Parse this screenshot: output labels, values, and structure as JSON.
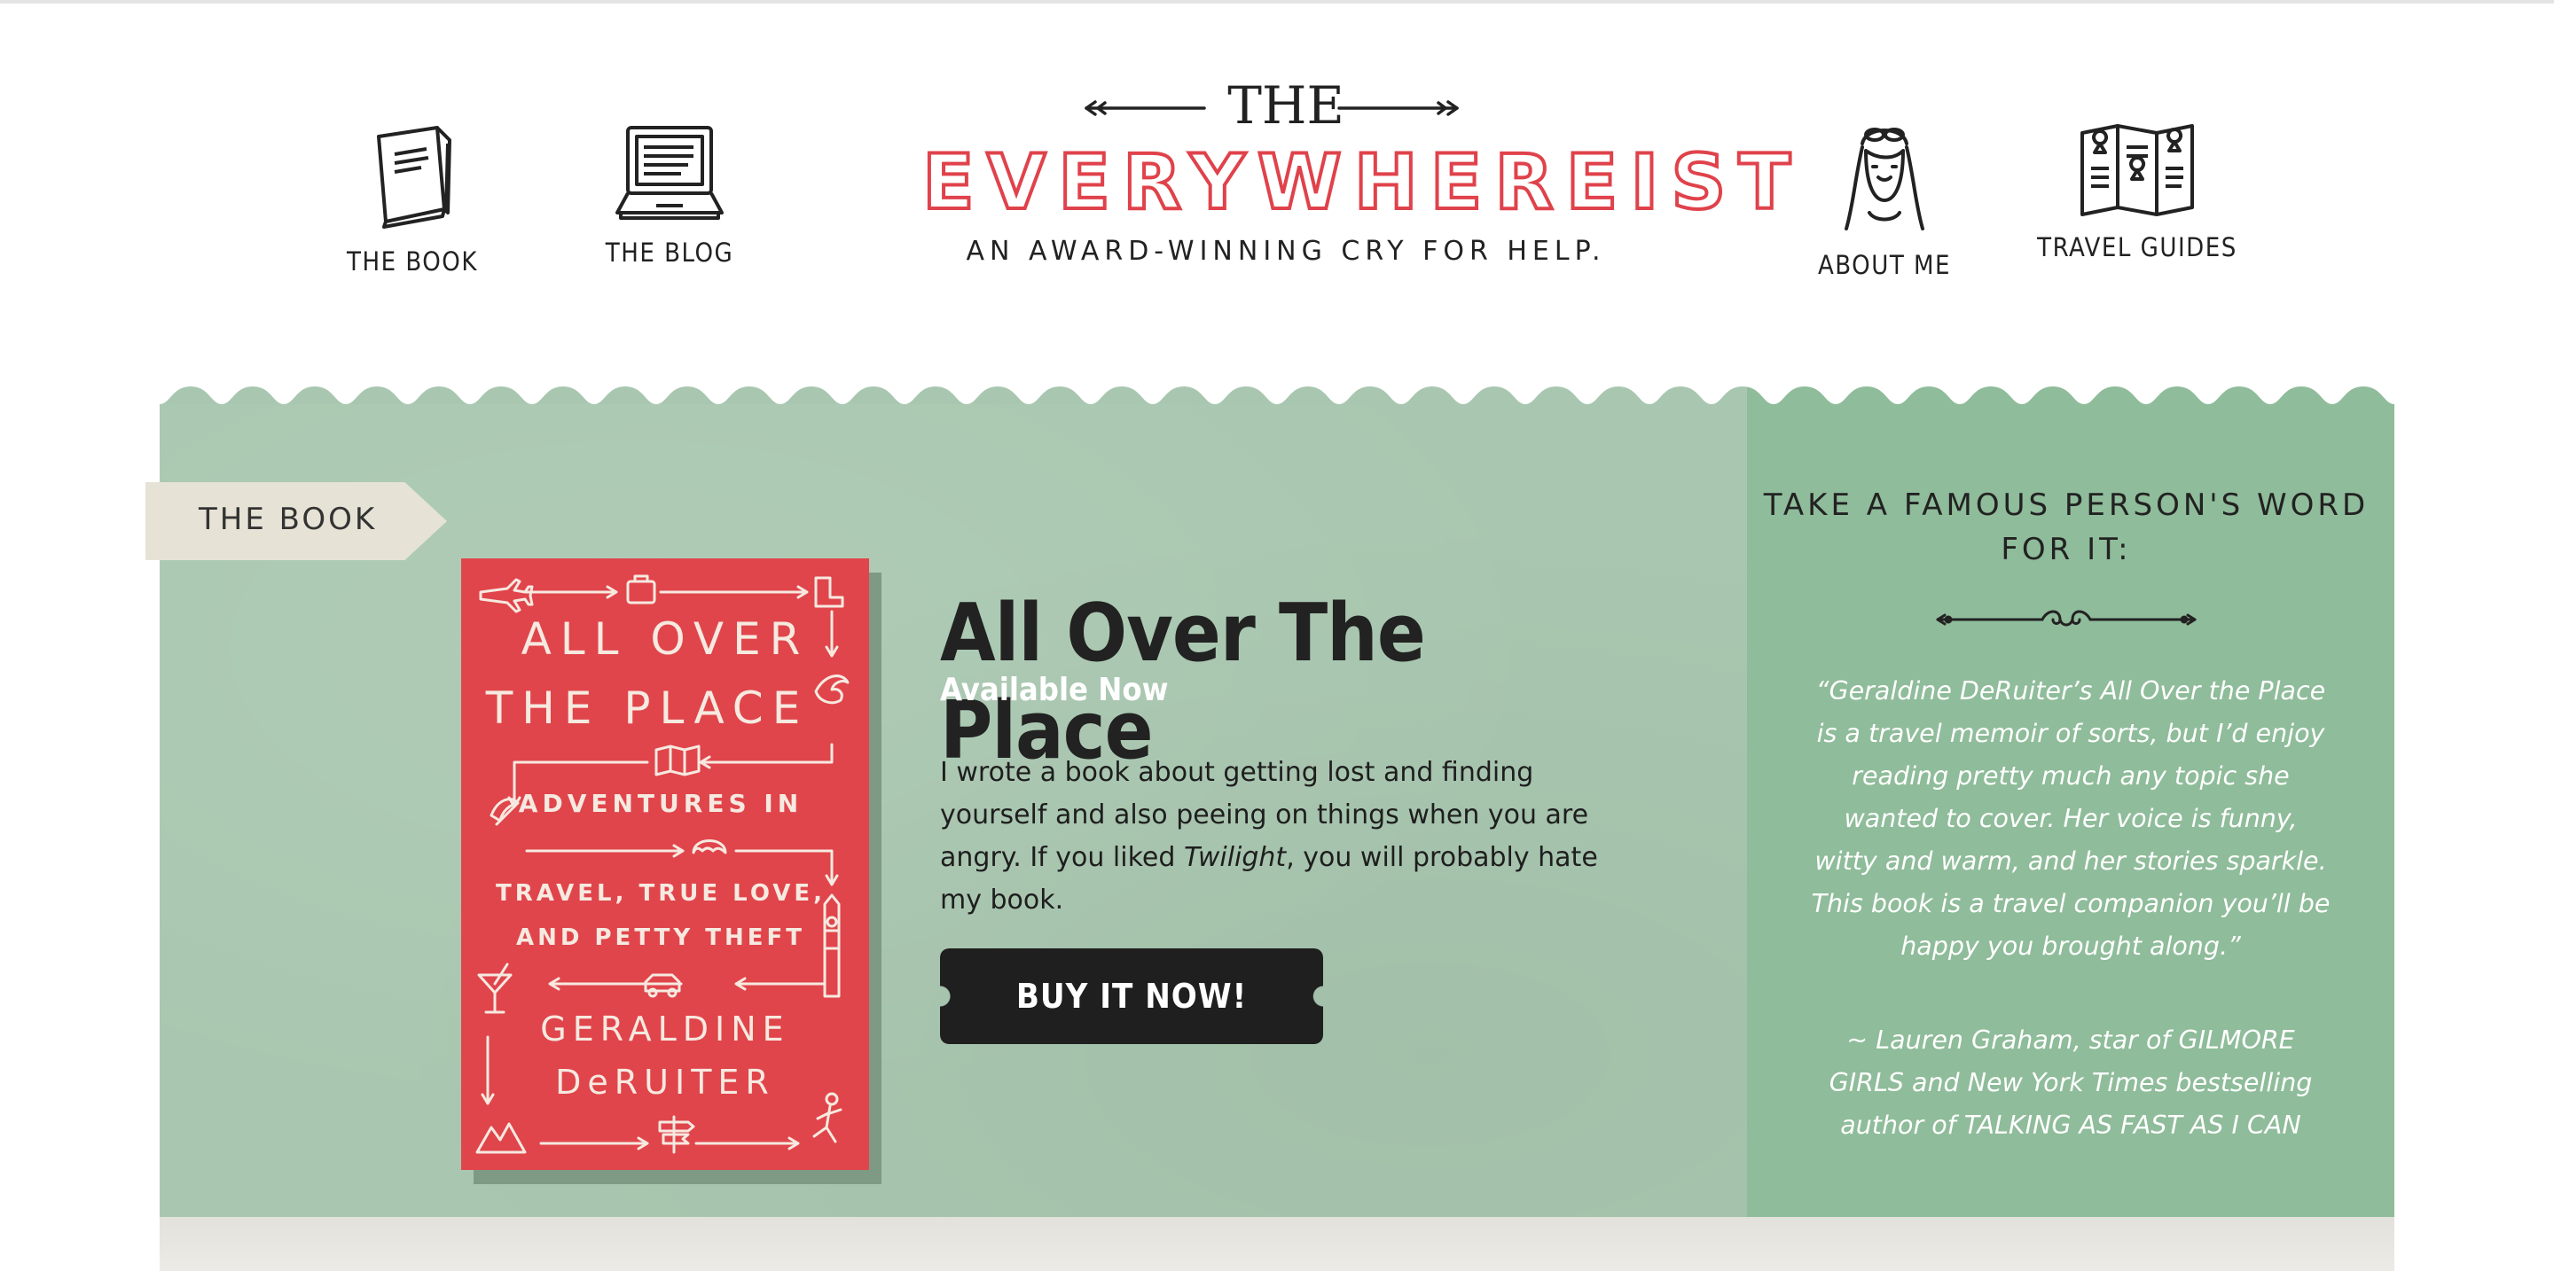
{
  "nav": {
    "book": "THE BOOK",
    "blog": "THE BLOG",
    "about": "ABOUT ME",
    "guides": "TRAVEL GUIDES"
  },
  "logo": {
    "the": "THE",
    "name": "EVERYWHEREIST",
    "tagline": "AN AWARD-WINNING CRY FOR HELP."
  },
  "section": {
    "tab_label": "THE BOOK"
  },
  "book": {
    "cover": {
      "title_line1": "ALL OVER",
      "title_line2": "THE PLACE",
      "sub_line1": "ADVENTURES IN",
      "sub_line2": "TRAVEL, TRUE LOVE,",
      "sub_line3": "AND PETTY THEFT",
      "author_line1": "GERALDINE",
      "author_line2": "DeRUITER"
    },
    "title": "All Over The Place",
    "availability": "Available Now",
    "blurb_part1": "I wrote a book about getting lost and finding yourself and also peeing on things when you are angry. If you liked ",
    "blurb_italic": "Twilight",
    "blurb_part2": ", you will probably hate my book.",
    "buy_label": "BUY IT NOW!"
  },
  "sidebar": {
    "heading": "TAKE A FAMOUS PERSON'S WORD FOR IT:",
    "quote": "“Geraldine DeRuiter’s All Over the Place is a travel memoir of sorts, but I’d enjoy reading pretty much any topic she wanted to cover. Her voice is funny, witty and warm, and her stories sparkle.  This book is a travel companion you’ll be happy you brought along.”",
    "attribution": "~ Lauren Graham, star of GILMORE GIRLS and New York Times bestselling author of TALKING AS FAST AS I CAN"
  },
  "colors": {
    "accent_red": "#e0424b",
    "band_green": "#a9c7b0",
    "side_green": "#8fbc9a",
    "button_dark": "#1f1f1f",
    "tab_cream": "#e6e3d6"
  },
  "icons": [
    "book-icon",
    "laptop-icon",
    "woman-portrait-icon",
    "folded-map-icon",
    "arrow-ornament-icon",
    "ornamental-divider-icon"
  ]
}
